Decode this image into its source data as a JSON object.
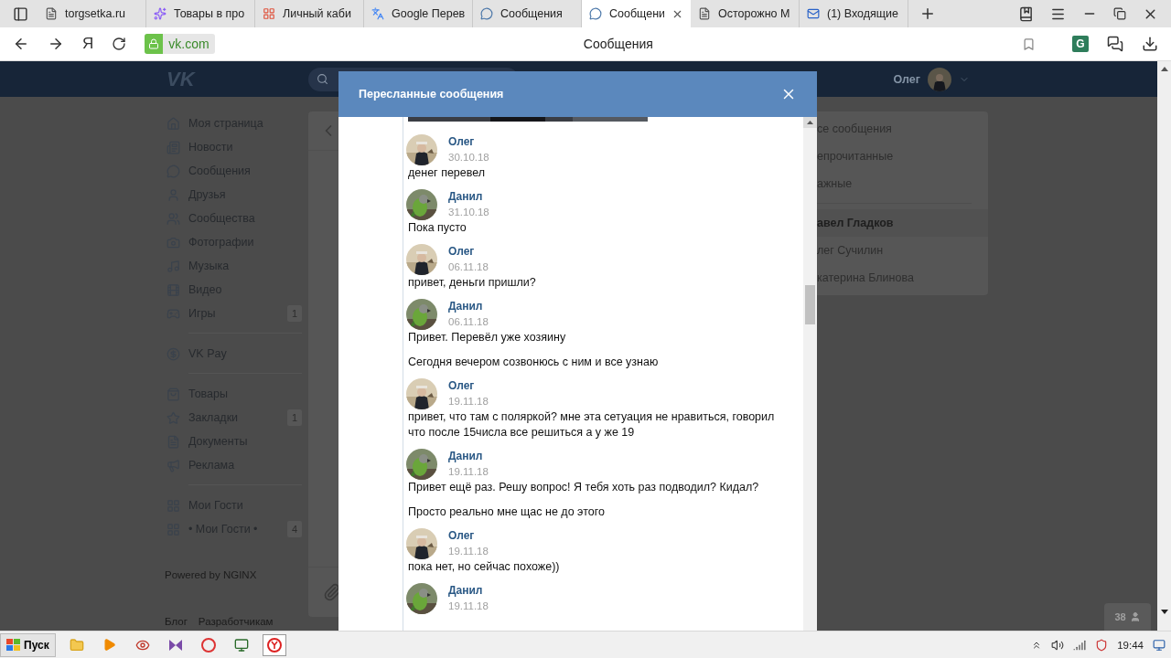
{
  "browser": {
    "tabs": [
      {
        "title": "torgsetka.ru",
        "kind": "page",
        "selected": false
      },
      {
        "title": "Товары в про",
        "kind": "sparkle",
        "selected": false
      },
      {
        "title": "Личный каби",
        "kind": "dots",
        "selected": false
      },
      {
        "title": "Google Перев",
        "kind": "translate",
        "selected": false
      },
      {
        "title": "Сообщения",
        "kind": "chat",
        "selected": false
      },
      {
        "title": "Сообщени",
        "kind": "chat",
        "selected": true
      },
      {
        "title": "Осторожно М",
        "kind": "page",
        "selected": false
      },
      {
        "title": "(1) Входящие",
        "kind": "mail",
        "selected": false
      }
    ],
    "home_label": "Я",
    "host": "vk.com",
    "page_title": "Сообщения",
    "extension_label": "G"
  },
  "vk_header": {
    "logo": "VK",
    "user_name": "Олег"
  },
  "sidebar": {
    "groups": [
      {
        "items": [
          {
            "label": "Моя страница",
            "kind": "home"
          },
          {
            "label": "Новости",
            "kind": "news"
          },
          {
            "label": "Сообщения",
            "kind": "chat"
          },
          {
            "label": "Друзья",
            "kind": "user"
          },
          {
            "label": "Сообщества",
            "kind": "users"
          },
          {
            "label": "Фотографии",
            "kind": "camera"
          },
          {
            "label": "Музыка",
            "kind": "music"
          },
          {
            "label": "Видео",
            "kind": "film"
          },
          {
            "label": "Игры",
            "kind": "game",
            "badge": "1"
          }
        ]
      },
      {
        "items": [
          {
            "label": "VK Pay",
            "kind": "pay"
          }
        ]
      },
      {
        "items": [
          {
            "label": "Товары",
            "kind": "bag"
          },
          {
            "label": "Закладки",
            "kind": "star",
            "badge": "1"
          },
          {
            "label": "Документы",
            "kind": "doc"
          },
          {
            "label": "Реклама",
            "kind": "megaphone"
          }
        ]
      },
      {
        "items": [
          {
            "label": "Мои Гости",
            "kind": "grid"
          },
          {
            "label": "• Мои Гости •",
            "kind": "grid",
            "badge": "4"
          }
        ]
      }
    ],
    "powered": "Powered by NGINX",
    "footer_links": [
      "Блог",
      "Разработчикам"
    ]
  },
  "right_menu": {
    "filters": [
      "се сообщения",
      "епрочитанные",
      "ажные"
    ],
    "conversations": [
      {
        "name": "авел Гладков",
        "selected": true
      },
      {
        "name": "лег Сучилин",
        "selected": false
      },
      {
        "name": "катерина Блинова",
        "selected": false
      }
    ]
  },
  "online_counter": "38",
  "modal": {
    "title": "Пересланные сообщения",
    "messages": [
      {
        "author": "Олег",
        "kind": "person",
        "date": "30.10.18",
        "texts": [
          "денег перевел"
        ]
      },
      {
        "author": "Данил",
        "kind": "bird",
        "date": "31.10.18",
        "texts": [
          "Пока пусто"
        ]
      },
      {
        "author": "Олег",
        "kind": "person",
        "date": "06.11.18",
        "texts": [
          "привет, деньги пришли?"
        ]
      },
      {
        "author": "Данил",
        "kind": "bird",
        "date": "06.11.18",
        "texts": [
          "Привет. Перевёл уже хозяину",
          "Сегодня вечером созвонюсь с ним и все узнаю"
        ]
      },
      {
        "author": "Олег",
        "kind": "person",
        "date": "19.11.18",
        "texts": [
          "привет, что там с поляркой? мне эта сетуация не нравиться, говорил что после 15числа все решиться а у же 19"
        ]
      },
      {
        "author": "Данил",
        "kind": "bird",
        "date": "19.11.18",
        "texts": [
          "Привет ещё раз. Решу вопрос! Я тебя хоть раз подводил? Кидал?",
          "Просто реально мне щас не до этого"
        ]
      },
      {
        "author": "Олег",
        "kind": "person",
        "date": "19.11.18",
        "texts": [
          "пока нет, но сейчас похоже))"
        ]
      },
      {
        "author": "Данил",
        "kind": "bird",
        "date": "19.11.18"
      }
    ]
  },
  "taskbar": {
    "start_label": "Пуск",
    "clock": "19:44"
  }
}
